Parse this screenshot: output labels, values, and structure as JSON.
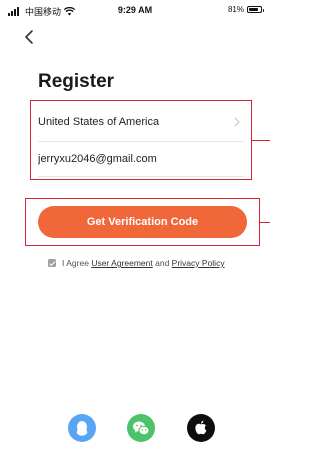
{
  "status_bar": {
    "carrier": "中国移动",
    "time": "9:29 AM",
    "battery": "81%",
    "icons": [
      "signal-icon",
      "wifi-icon",
      "battery-icon"
    ]
  },
  "nav": {
    "back_icon": "back-chevron-icon"
  },
  "page": {
    "title": "Register"
  },
  "form": {
    "country": "United States of America",
    "country_icon": "chevron-right-icon",
    "email_value": "jerryxu2046@gmail.com"
  },
  "button": {
    "verify_label": "Get Verification Code",
    "color": "#f0683a"
  },
  "agreement": {
    "checked": true,
    "prefix": "I Agree",
    "user_agreement": "User Agreement",
    "and": "and",
    "privacy_policy": "Privacy Policy"
  },
  "social_login": [
    {
      "name": "qq",
      "icon": "qq-icon",
      "color": "#5aa5f3"
    },
    {
      "name": "wechat",
      "icon": "wechat-icon",
      "color": "#4cc36b"
    },
    {
      "name": "apple",
      "icon": "apple-icon",
      "color": "#0d0d0d"
    }
  ],
  "annotation_color": "#d6253a"
}
